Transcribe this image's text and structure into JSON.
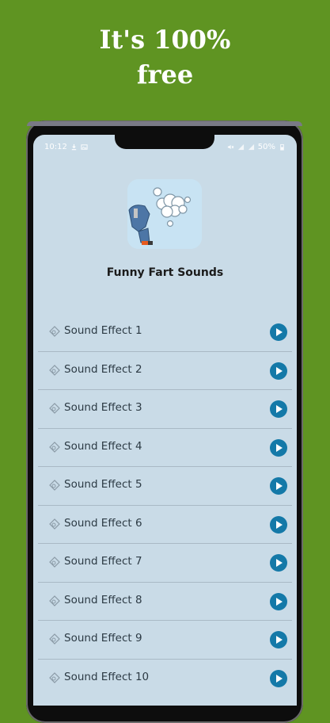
{
  "promo": {
    "headline_line1": "It's 100%",
    "headline_line2": "free"
  },
  "status_bar": {
    "time": "10:12",
    "battery": "50%"
  },
  "app": {
    "title": "Funny Fart Sounds"
  },
  "sound_list": {
    "items": [
      {
        "label": "Sound Effect 1"
      },
      {
        "label": "Sound Effect 2"
      },
      {
        "label": "Sound Effect 3"
      },
      {
        "label": "Sound Effect 4"
      },
      {
        "label": "Sound Effect 5"
      },
      {
        "label": "Sound Effect 6"
      },
      {
        "label": "Sound Effect 7"
      },
      {
        "label": "Sound Effect 8"
      },
      {
        "label": "Sound Effect 9"
      },
      {
        "label": "Sound Effect 10"
      }
    ],
    "item_icon": "music-note-icon",
    "action_icon": "play-icon"
  },
  "colors": {
    "background": "#5f9422",
    "screen": "#c9dbe7",
    "play_button": "#1479a8",
    "title_text": "#1b1b1b"
  }
}
